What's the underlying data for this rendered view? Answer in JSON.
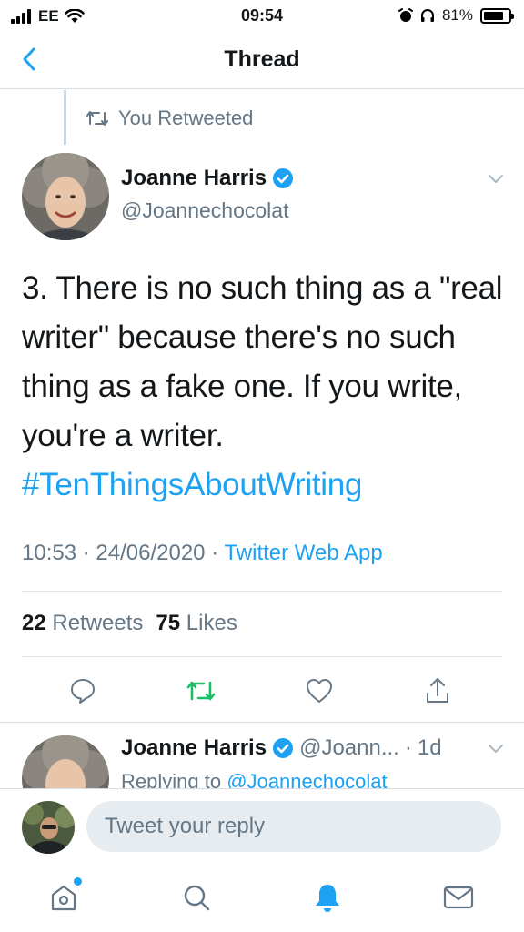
{
  "status_bar": {
    "carrier": "EE",
    "time": "09:54",
    "battery": "81%",
    "battery_level": 0.81
  },
  "nav": {
    "title": "Thread"
  },
  "retweet_context": {
    "label": "You Retweeted"
  },
  "tweet": {
    "author_name": "Joanne Harris",
    "author_handle": "@Joannechocolat",
    "text": "3. There is no such thing as a \"real writer\" because there's no such thing as a fake one. If you write, you're a writer.",
    "hashtag": "#TenThingsAboutWriting",
    "time": "10:53",
    "date": "24/06/2020",
    "source": "Twitter Web App",
    "retweets_count": "22",
    "retweets_label": "Retweets",
    "likes_count": "75",
    "likes_label": "Likes"
  },
  "reply": {
    "author_name": "Joanne Harris",
    "author_handle": "@Joann...",
    "age": "1d",
    "replying_to_label": "Replying to",
    "replying_to_handle": "@Joannechocolat"
  },
  "composer": {
    "placeholder": "Tweet your reply"
  },
  "colors": {
    "accent": "#1da1f2",
    "retweet_green": "#17bf63",
    "muted": "#657786"
  },
  "tabs": [
    "home-icon",
    "search-icon",
    "notifications-icon",
    "messages-icon"
  ]
}
